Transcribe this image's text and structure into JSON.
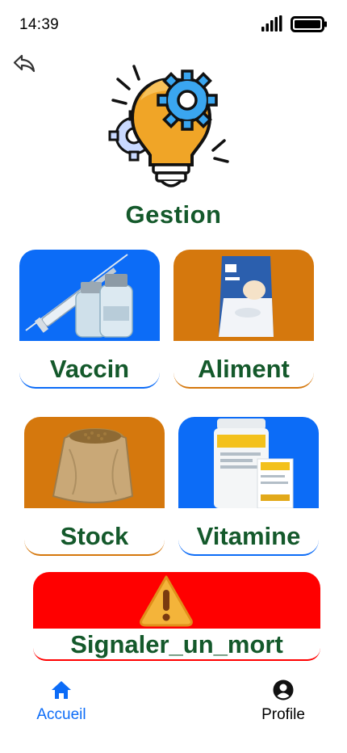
{
  "status": {
    "time": "14:39"
  },
  "header": {
    "title": "Gestion"
  },
  "cards": [
    {
      "label": "Vaccin",
      "image": "vaccine-vials-syringe",
      "color": "#0c6cf7",
      "accent": "#0c6cf7"
    },
    {
      "label": "Aliment",
      "image": "feed-bag",
      "color": "#d5780d",
      "accent": "#d5780d"
    },
    {
      "label": "Stock",
      "image": "grain-sack",
      "color": "#d5780d",
      "accent": "#d5780d"
    },
    {
      "label": "Vitamine",
      "image": "vitamin-product",
      "color": "#0c6cf7",
      "accent": "#0c6cf7"
    }
  ],
  "alert_card": {
    "label": "Signaler_un_mort",
    "icon": "warning-icon",
    "color": "#ff0000"
  },
  "nav": {
    "home_label": "Accueil",
    "profile_label": "Profile",
    "active_color": "#0c6cf7"
  },
  "colors": {
    "title_green": "#14592b"
  }
}
